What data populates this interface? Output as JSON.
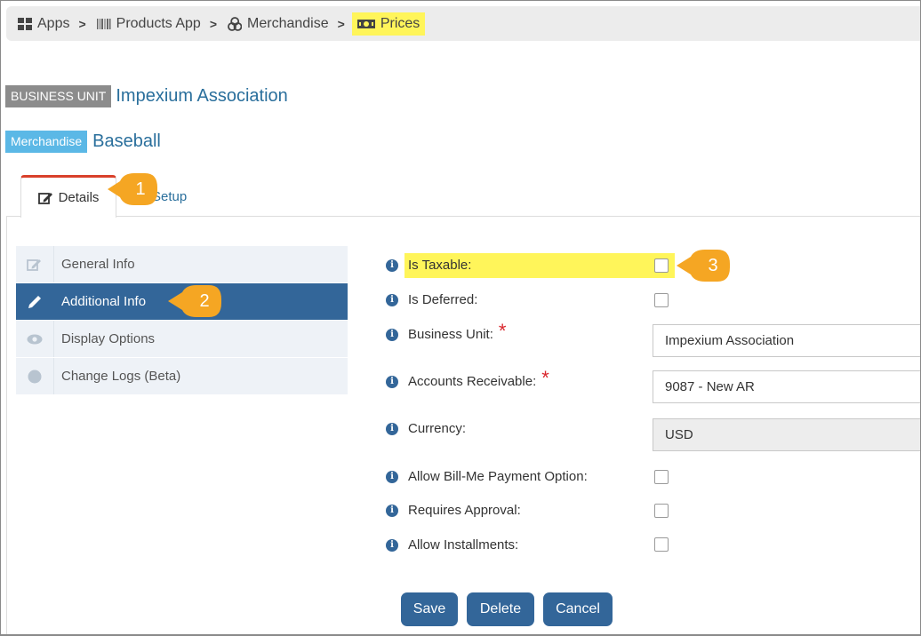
{
  "breadcrumb": {
    "items": [
      {
        "label": "Apps",
        "icon": "grid-icon"
      },
      {
        "label": "Products App",
        "icon": "barcode-icon"
      },
      {
        "label": "Merchandise",
        "icon": "boxes-icon"
      },
      {
        "label": "Prices",
        "icon": "money-icon"
      }
    ],
    "separator": ">"
  },
  "header": {
    "business_unit_tag": "BUSINESS UNIT",
    "business_unit_value": "Impexium Association",
    "merch_tag": "Merchandise",
    "merch_value": "Baseball"
  },
  "tabs": [
    {
      "label": "Details",
      "icon": "edit-icon",
      "active": true
    },
    {
      "label": "Setup",
      "active": false
    }
  ],
  "callouts": [
    "1",
    "2",
    "3"
  ],
  "sidenav": [
    {
      "label": "General Info",
      "icon": "edit-icon"
    },
    {
      "label": "Additional Info",
      "icon": "pencil-icon",
      "active": true
    },
    {
      "label": "Display Options",
      "icon": "eye-icon"
    },
    {
      "label": "Change Logs (Beta)",
      "icon": "circle-icon"
    }
  ],
  "form": {
    "is_taxable": {
      "label": "Is Taxable:",
      "checked": false
    },
    "is_deferred": {
      "label": "Is Deferred:",
      "checked": false
    },
    "business_unit": {
      "label": "Business Unit:",
      "value": "Impexium Association",
      "required": "*"
    },
    "accounts_receivable": {
      "label": "Accounts Receivable:",
      "value": "9087 - New AR",
      "required": "*"
    },
    "currency": {
      "label": "Currency:",
      "value": "USD"
    },
    "allow_bill_me": {
      "label": "Allow Bill-Me Payment Option:",
      "checked": false
    },
    "requires_approval": {
      "label": "Requires Approval:",
      "checked": false
    },
    "allow_installments": {
      "label": "Allow Installments:",
      "checked": false
    },
    "info_glyph": "i"
  },
  "buttons": {
    "save": "Save",
    "delete": "Delete",
    "cancel": "Cancel"
  },
  "colors": {
    "primary": "#336699",
    "highlight": "#fff55a",
    "callout": "#f5a623",
    "required": "#d9262c",
    "tab_accent": "#d9402a"
  }
}
